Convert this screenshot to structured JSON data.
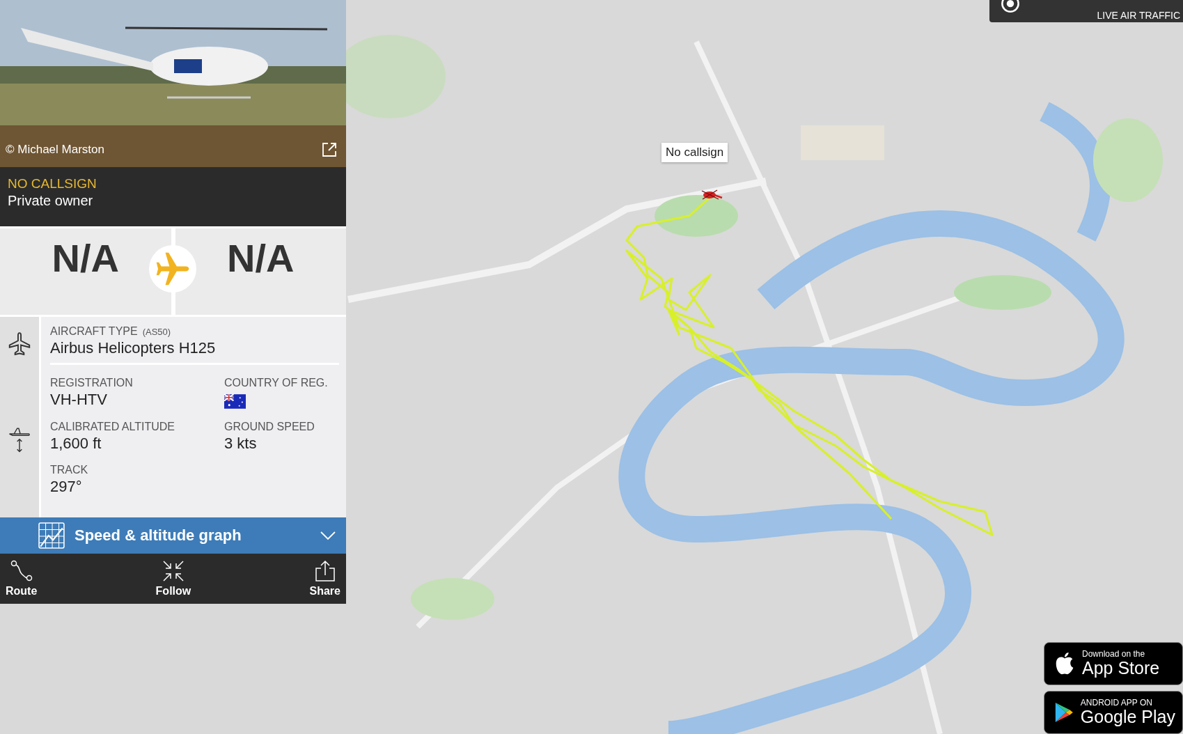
{
  "map": {
    "marker_label": "No callsign"
  },
  "logo": {
    "tagline": "LIVE AIR TRAFFIC"
  },
  "photo": {
    "credit": "© Michael Marston"
  },
  "flight": {
    "callsign": "NO CALLSIGN",
    "owner": "Private owner"
  },
  "route": {
    "origin": "N/A",
    "destination": "N/A"
  },
  "details": {
    "type_label": "AIRCRAFT TYPE",
    "type_code": "(AS50)",
    "type_value": "Airbus Helicopters H125",
    "fields": [
      {
        "label": "REGISTRATION",
        "kind": "text",
        "value": "VH-HTV"
      },
      {
        "label": "COUNTRY OF REG.",
        "kind": "flag"
      },
      {
        "label": "CALIBRATED ALTITUDE",
        "kind": "text",
        "value": "1,600 ft"
      },
      {
        "label": "GROUND SPEED",
        "kind": "text",
        "value": "3 kts"
      },
      {
        "label": "TRACK",
        "kind": "text",
        "value": "297°"
      }
    ]
  },
  "graph_bar": {
    "label": "Speed & altitude graph",
    "expanded": false
  },
  "actions": [
    {
      "kind": "route",
      "label": "Route"
    },
    {
      "kind": "follow",
      "label": "Follow"
    },
    {
      "kind": "share",
      "label": "Share"
    }
  ],
  "badges": [
    {
      "kind": "apple",
      "small": "Download on the",
      "large": "App Store"
    },
    {
      "kind": "google",
      "small": "ANDROID APP ON",
      "large": "Google Play"
    }
  ]
}
